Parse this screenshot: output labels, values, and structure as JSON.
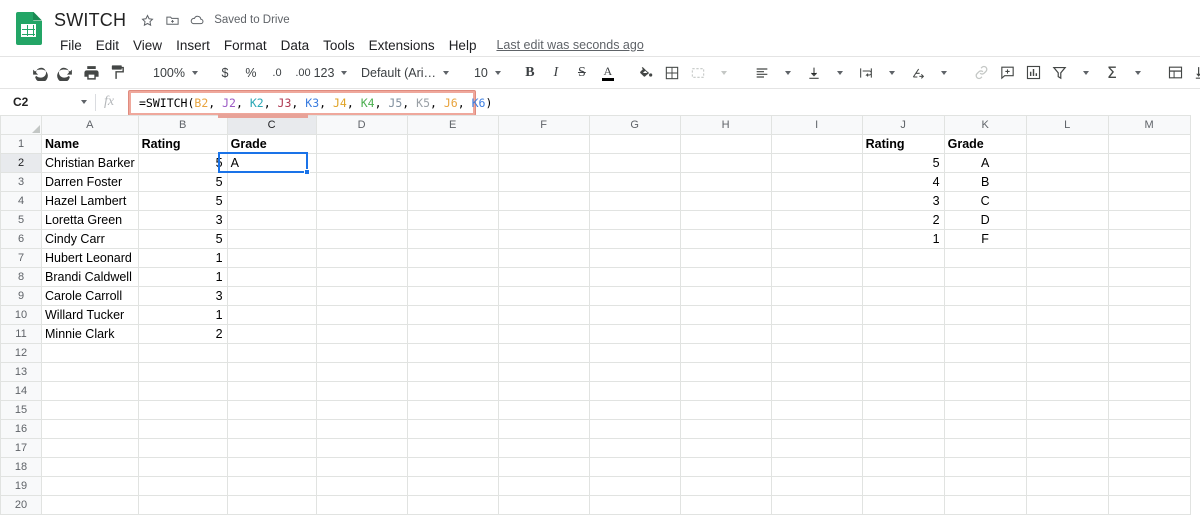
{
  "header": {
    "doc_title": "SWITCH",
    "star_icon": "star-icon",
    "move_icon": "move-to-folder-icon",
    "cloud_icon": "cloud-saved-icon",
    "saved_status": "Saved to Drive",
    "menu": [
      "File",
      "Edit",
      "View",
      "Insert",
      "Format",
      "Data",
      "Tools",
      "Extensions",
      "Help"
    ],
    "last_edit": "Last edit was seconds ago"
  },
  "toolbar": {
    "undo": "undo-icon",
    "redo": "redo-icon",
    "print": "print-icon",
    "paint_format": "paint-format-icon",
    "zoom_value": "100%",
    "currency": "$",
    "percent": "%",
    "dec_decrease": ".0",
    "dec_increase": ".00",
    "more_formats": "123",
    "font_name": "Default (Ari…",
    "font_size": "10",
    "bold": "B",
    "italic": "I",
    "strikethrough": "S",
    "text_color": "A",
    "fill_color": "fill-color-icon",
    "borders": "borders-icon",
    "merge_cells": "merge-cells-icon",
    "halign": "horizontal-align-icon",
    "valign": "vertical-align-icon",
    "text_wrap": "text-wrapping-icon",
    "text_rotation": "text-rotation-icon",
    "insert_link": "link-icon",
    "insert_comment": "comment-icon",
    "insert_chart": "chart-icon",
    "create_filter": "filter-icon",
    "functions": "sigma-icon",
    "freeze": "freeze-icon",
    "indent_less": "indent-less-icon",
    "indent_more": "indent-more-icon"
  },
  "formula_bar": {
    "name_box": "C2",
    "fx_label": "fx",
    "tokens": [
      {
        "text": "=SWITCH(",
        "color": "#000000"
      },
      {
        "text": "B2",
        "color": "#e8a33d"
      },
      {
        "text": ", ",
        "color": "#000000"
      },
      {
        "text": "J2",
        "color": "#9b59c4"
      },
      {
        "text": ", ",
        "color": "#000000"
      },
      {
        "text": "K2",
        "color": "#2aa8b5"
      },
      {
        "text": ", ",
        "color": "#000000"
      },
      {
        "text": "J3",
        "color": "#b03a52"
      },
      {
        "text": ", ",
        "color": "#000000"
      },
      {
        "text": "K3",
        "color": "#3b7de0"
      },
      {
        "text": ", ",
        "color": "#000000"
      },
      {
        "text": "J4",
        "color": "#e0a326"
      },
      {
        "text": ", ",
        "color": "#000000"
      },
      {
        "text": "K4",
        "color": "#4caf50"
      },
      {
        "text": ", ",
        "color": "#000000"
      },
      {
        "text": "J5",
        "color": "#7f8f9e"
      },
      {
        "text": ", ",
        "color": "#000000"
      },
      {
        "text": "K5",
        "color": "#9aa0a6"
      },
      {
        "text": ", ",
        "color": "#000000"
      },
      {
        "text": "J6",
        "color": "#e8a33d"
      },
      {
        "text": ", ",
        "color": "#000000"
      },
      {
        "text": "K6",
        "color": "#3b7de0"
      },
      {
        "text": ")",
        "color": "#000000"
      }
    ],
    "highlight_color": "#efa89c"
  },
  "grid": {
    "columns": [
      "A",
      "B",
      "C",
      "D",
      "E",
      "F",
      "G",
      "H",
      "I",
      "J",
      "K",
      "L",
      "M"
    ],
    "selected_column": "C",
    "selected_row": 2,
    "selected_cell": "C2",
    "rows": [
      1,
      2,
      3,
      4,
      5,
      6,
      7,
      8,
      9,
      10,
      11,
      12,
      13,
      14,
      15,
      16,
      17,
      18,
      19,
      20
    ],
    "data": {
      "A": [
        "Name",
        "Christian Barker",
        "Darren Foster",
        "Hazel Lambert",
        "Loretta Green",
        "Cindy Carr",
        "Hubert Leonard",
        "Brandi Caldwell",
        "Carole Carroll",
        "Willard Tucker",
        "Minnie Clark"
      ],
      "B": [
        "Rating",
        "5",
        "5",
        "5",
        "3",
        "5",
        "1",
        "1",
        "3",
        "1",
        "2"
      ],
      "C": [
        "Grade",
        "A",
        "",
        "",
        "",
        "",
        "",
        "",
        "",
        "",
        ""
      ],
      "J": [
        "Rating",
        "5",
        "4",
        "3",
        "2",
        "1"
      ],
      "K": [
        "Grade",
        "A",
        "B",
        "C",
        "D",
        "F"
      ]
    }
  }
}
